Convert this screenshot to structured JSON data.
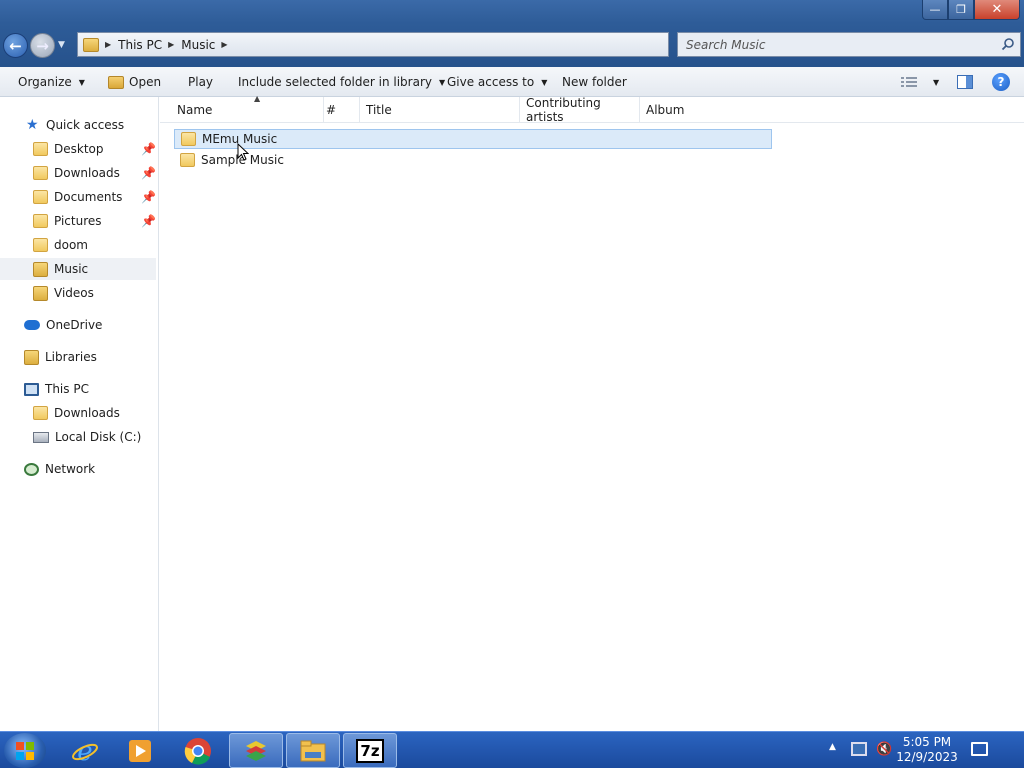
{
  "window": {
    "minimize_glyph": "—",
    "maximize_glyph": "❐",
    "close_glyph": "✕"
  },
  "addressbar": {
    "breadcrumb": [
      "This PC",
      "Music"
    ]
  },
  "search": {
    "placeholder": "Search Music"
  },
  "toolbar": {
    "organize": "Organize",
    "open": "Open",
    "play": "Play",
    "include": "Include selected folder in library",
    "give_access": "Give access to",
    "new_folder": "New folder",
    "help": "?"
  },
  "navpane": {
    "quick_access": "Quick access",
    "quick_items": [
      {
        "label": "Desktop",
        "pinned": true
      },
      {
        "label": "Downloads",
        "pinned": true
      },
      {
        "label": "Documents",
        "pinned": true
      },
      {
        "label": "Pictures",
        "pinned": true
      },
      {
        "label": "doom",
        "pinned": false
      },
      {
        "label": "Music",
        "pinned": false,
        "selected": true
      },
      {
        "label": "Videos",
        "pinned": false
      }
    ],
    "onedrive": "OneDrive",
    "libraries": "Libraries",
    "this_pc": "This PC",
    "pc_items": [
      "Downloads",
      "Local Disk (C:)"
    ],
    "network": "Network"
  },
  "columns": {
    "name": "Name",
    "number": "#",
    "title": "Title",
    "artists": "Contributing artists",
    "album": "Album"
  },
  "files": [
    {
      "name": "MEmu Music",
      "selected": true
    },
    {
      "name": "Sample Music",
      "selected": false
    }
  ],
  "taskbar": {
    "apps": [
      "internet-explorer",
      "media-player",
      "chrome",
      "bluestacks",
      "file-explorer",
      "7-zip"
    ],
    "sevenzip_label": "7z",
    "time": "5:05 PM",
    "date": "12/9/2023"
  },
  "colors": {
    "titlebar": "#2e5c98",
    "selection": "#dbeaf9",
    "taskbar": "#1b4a9d"
  }
}
